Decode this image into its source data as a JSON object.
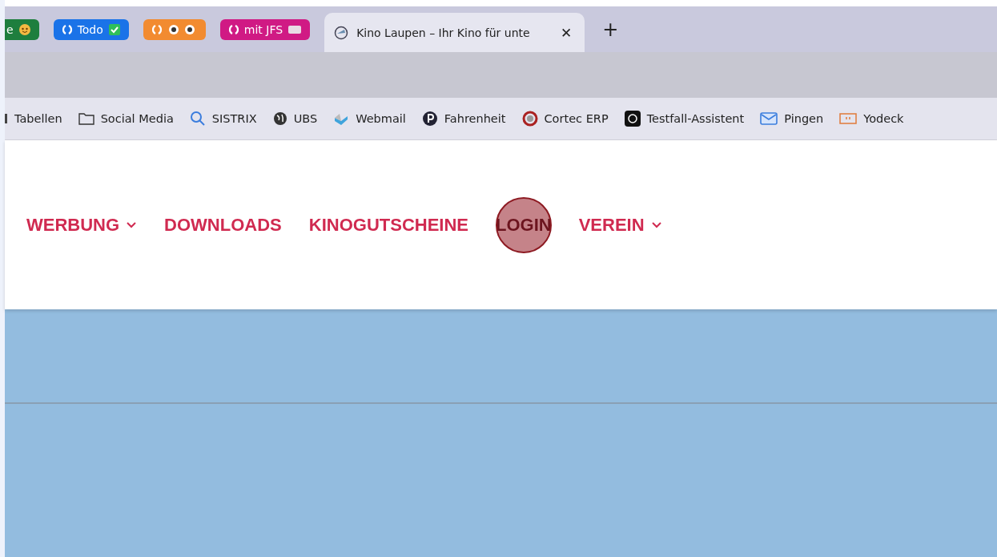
{
  "tab_groups": [
    {
      "label": "e",
      "color": "#1e7e3e",
      "kind": "face"
    },
    {
      "label": "Todo",
      "color": "#1a73e8",
      "kind": "check"
    },
    {
      "color": "#f28b30",
      "kind": "eyes"
    },
    {
      "label": "mit JFS",
      "color": "#d01a84",
      "kind": "card"
    }
  ],
  "active_tab": {
    "title": "Kino Laupen – Ihr Kino für unte",
    "close": "✕"
  },
  "new_tab": "+",
  "bookmarks": [
    {
      "label": "Tabellen",
      "kind": "sheet"
    },
    {
      "label": "Social Media",
      "kind": "folder"
    },
    {
      "label": "SISTRIX",
      "kind": "search"
    },
    {
      "label": "UBS",
      "kind": "globe"
    },
    {
      "label": "Webmail",
      "kind": "cube"
    },
    {
      "label": "Fahrenheit",
      "kind": "p"
    },
    {
      "label": "Cortec ERP",
      "kind": "cortec"
    },
    {
      "label": "Testfall-Assistent",
      "kind": "knot"
    },
    {
      "label": "Pingen",
      "kind": "mail"
    },
    {
      "label": "Yodeck",
      "kind": "screen"
    }
  ],
  "nav": [
    {
      "label": "WERBUNG",
      "dropdown": true,
      "highlighted": false
    },
    {
      "label": "DOWNLOADS",
      "dropdown": false,
      "highlighted": false
    },
    {
      "label": "KINOGUTSCHEINE",
      "dropdown": false,
      "highlighted": false
    },
    {
      "label": "LOGIN",
      "dropdown": false,
      "highlighted": true
    },
    {
      "label": "VEREIN",
      "dropdown": true,
      "highlighted": false
    }
  ]
}
